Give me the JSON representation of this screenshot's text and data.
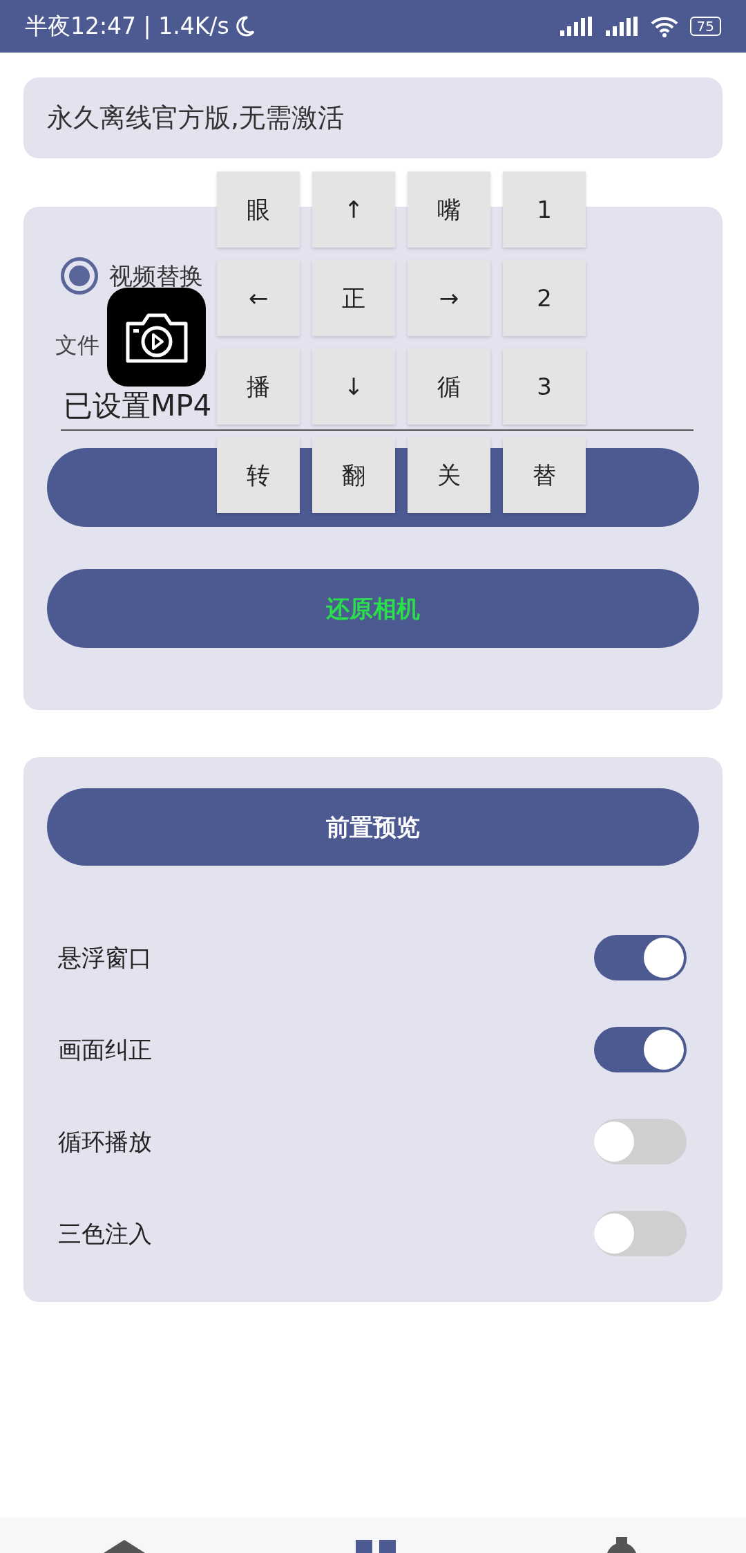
{
  "status_bar": {
    "time": "半夜12:47 | 1.4K/s",
    "battery": "75"
  },
  "notice": "永久离线官方版,无需激活",
  "mode_options": [
    {
      "label": "视频替换",
      "selected": true
    }
  ],
  "file_field": {
    "label": "文件",
    "value": "已设置MP4"
  },
  "action_buttons": [
    {
      "kind": "blank"
    },
    {
      "kind": "labeled",
      "label": "还原相机"
    }
  ],
  "preview_button": "前置预览",
  "toggles": [
    {
      "label": "悬浮窗口",
      "on": true
    },
    {
      "label": "画面纠正",
      "on": true
    },
    {
      "label": "循环播放",
      "on": false
    },
    {
      "label": "三色注入",
      "on": false
    }
  ],
  "keypad": [
    "眼",
    "↑",
    "嘴",
    "1",
    "←",
    "正",
    "→",
    "2",
    "播",
    "↓",
    "循",
    "3",
    "转",
    "翻",
    "关",
    "替"
  ]
}
